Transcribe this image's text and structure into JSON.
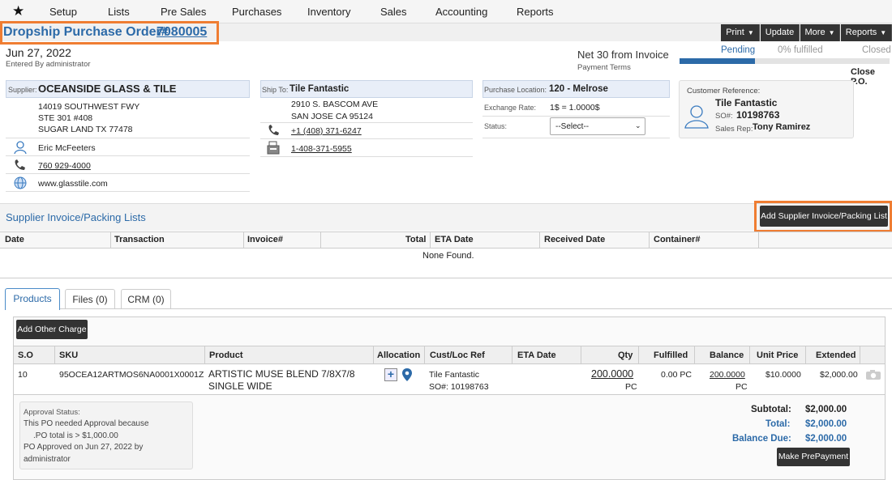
{
  "nav": {
    "items": [
      "Setup",
      "Lists",
      "Pre Sales",
      "Purchases",
      "Inventory",
      "Sales",
      "Accounting",
      "Reports"
    ]
  },
  "header": {
    "title_prefix": "Dropship Purchase Order#",
    "po_number": " 7080005",
    "buttons": {
      "print": "Print",
      "update": "Update",
      "more": "More",
      "reports": "Reports"
    }
  },
  "order": {
    "date": "Jun 27, 2022",
    "entered_by": "Entered By administrator",
    "payment_terms": "Net 30 from Invoice",
    "payment_terms_label": "Payment Terms",
    "status_pending": "Pending",
    "status_fulfilled": "0% fulfilled",
    "status_closed": "Closed",
    "fulfilled_fraction": 0.0,
    "close_po": "Close P.O."
  },
  "supplier": {
    "label": "Supplier:",
    "name": "OCEANSIDE GLASS & TILE",
    "addr1": "14019 SOUTHWEST FWY",
    "addr2": "STE 301 #408",
    "addr3": "SUGAR LAND TX 77478",
    "contact": "Eric McFeeters",
    "phone": "760 929-4000",
    "website": "www.glasstile.com"
  },
  "shipto": {
    "label": "Ship To:",
    "name": "Tile Fantastic",
    "addr1": "2910 S. BASCOM AVE",
    "addr2": "SAN JOSE CA 95124",
    "phone": "+1 (408) 371-6247",
    "fax": "1-408-371-5955"
  },
  "location": {
    "label": "Purchase Location:",
    "value": "120 - Melrose",
    "exchange_label": "Exchange Rate:",
    "exchange_value": "1$ = 1.0000$",
    "status_label": "Status:",
    "status_select": "--Select--"
  },
  "customer": {
    "ref_label": "Customer Reference:",
    "name": "Tile Fantastic",
    "so_label": "SO#:",
    "so_value": "10198763",
    "rep_label": "Sales Rep:",
    "rep_value": "Tony Ramirez"
  },
  "invoices": {
    "title": "Supplier Invoice/Packing Lists",
    "add_button": "Add Supplier Invoice/Packing List",
    "columns": [
      "Date",
      "Transaction",
      "Invoice#",
      "Total",
      "ETA Date",
      "Received Date",
      "Container#"
    ],
    "empty": "None Found."
  },
  "tabs": {
    "products": "Products",
    "files": "Files (0)",
    "crm": "CRM (0)"
  },
  "products": {
    "add_charge": "Add Other Charge",
    "columns": [
      "S.O",
      "SKU",
      "Product",
      "Allocation",
      "Cust/Loc Ref",
      "ETA Date",
      "Qty",
      "Fulfilled",
      "Balance",
      "Unit Price",
      "Extended"
    ],
    "row": {
      "so": "10",
      "sku": "95OCEA12ARTMOS6NA0001X0001Z",
      "product1": "ARTISTIC MUSE BLEND 7/8X7/8",
      "product2": "SINGLE WIDE",
      "cust_ref": "Tile Fantastic",
      "cust_so": "SO#: 10198763",
      "qty": "200.0000",
      "qty_unit": "PC",
      "fulfilled": "0.00 PC",
      "balance": "200.0000",
      "balance_unit": "PC",
      "unit_price": "$10.0000",
      "extended": "$2,000.00"
    }
  },
  "approval": {
    "label": "Approval Status:",
    "line1": "This PO needed Approval because",
    "line2": ".PO total is > $1,000.00",
    "line3": "PO Approved on Jun 27, 2022 by",
    "line4": "administrator"
  },
  "totals": {
    "subtotal_label": "Subtotal:",
    "subtotal": "$2,000.00",
    "total_label": "Total:",
    "total": "$2,000.00",
    "due_label": "Balance Due:",
    "due": "$2,000.00",
    "prepay_button": "Make PrePayment"
  },
  "colors": {
    "accent": "#2c6aa8",
    "highlight": "#ef7d32",
    "dark": "#333333"
  }
}
